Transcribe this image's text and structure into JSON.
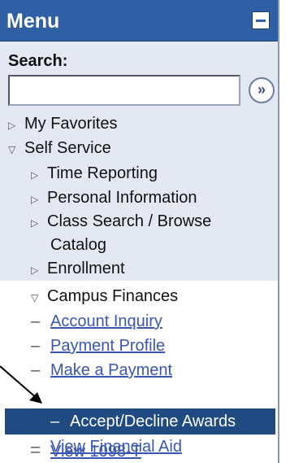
{
  "menu": {
    "title": "Menu",
    "search_label": "Search:",
    "search_value": "",
    "go_button": "»"
  },
  "items": {
    "my_favorites": "My Favorites",
    "self_service": "Self Service",
    "time_reporting": "Time Reporting",
    "personal_information": "Personal Information",
    "class_search_line1": "Class Search / Browse",
    "class_search_line2": "Catalog",
    "enrollment": "Enrollment",
    "campus_finances": "Campus Finances",
    "account_inquiry": "Account Inquiry",
    "payment_profile": "Payment Profile",
    "make_payment": "Make a Payment",
    "accept_decline": "Accept/Decline Awards",
    "view_financial_aid": "View Financial Aid",
    "view_1098t": "View 1098-T"
  },
  "glyphs": {
    "collapsed": "▷",
    "expanded": "▽",
    "dash": "–"
  },
  "colors": {
    "header_bg": "#2f5fa5",
    "selected_bg": "#1f4b82",
    "link": "#3a56b5"
  }
}
